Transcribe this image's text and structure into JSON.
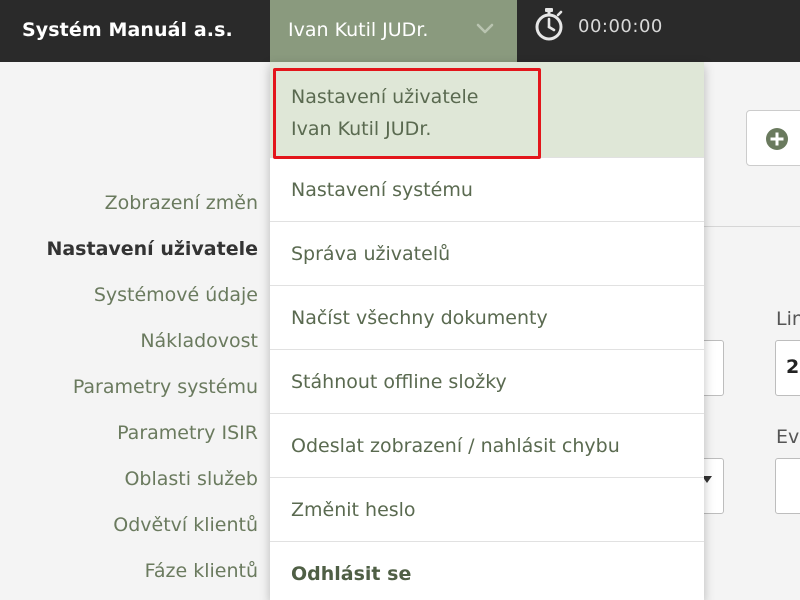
{
  "topbar": {
    "brand": "Systém Manuál a.s.",
    "user_name": "Ivan Kutil JUDr.",
    "timer": "00:00:00",
    "icons": {
      "user_menu": "chevron-down-icon",
      "timer": "stopwatch-icon"
    }
  },
  "leftnav": {
    "items": [
      {
        "label": "Zobrazení změn",
        "active": false
      },
      {
        "label": "Nastavení uživatele",
        "active": true
      },
      {
        "label": "Systémové údaje",
        "active": false
      },
      {
        "label": "Nákladovost",
        "active": false
      },
      {
        "label": "Parametry systému",
        "active": false
      },
      {
        "label": "Parametry ISIR",
        "active": false
      },
      {
        "label": "Oblasti služeb",
        "active": false
      },
      {
        "label": "Odvětví klientů",
        "active": false
      },
      {
        "label": "Fáze klientů",
        "active": false
      }
    ]
  },
  "content": {
    "add_icon": "plus-circle-icon",
    "field1_label": "Lin",
    "field1_value": "2",
    "field2_label": "Ev"
  },
  "dropdown": {
    "user_settings_line1": "Nastavení uživatele",
    "user_settings_line2": "Ivan Kutil JUDr.",
    "items": [
      "Nastavení systému",
      "Správa uživatelů",
      "Načíst všechny dokumenty",
      "Stáhnout offline složky",
      "Odeslat zobrazení / nahlásit chybu",
      "Změnit heslo"
    ],
    "logout": "Odhlásit se"
  },
  "colors": {
    "topbar_bg": "#2a2a2a",
    "user_menu_bg": "#8a9a7e",
    "accent_green": "#6a7a5e",
    "highlight_red": "#e3161b",
    "selected_item_bg": "#dfe7d7"
  }
}
